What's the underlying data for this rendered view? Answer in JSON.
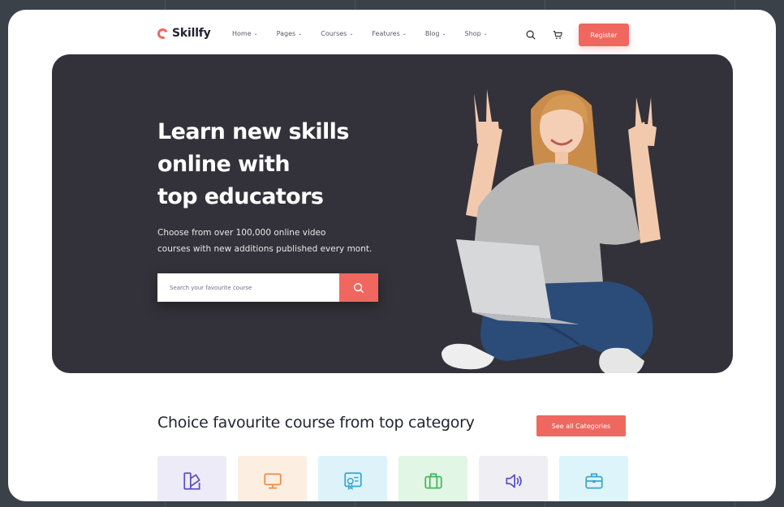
{
  "brand": {
    "name": "Skillfy",
    "accent": "#f0675f"
  },
  "nav": {
    "items": [
      {
        "label": "Home"
      },
      {
        "label": "Pages"
      },
      {
        "label": "Courses"
      },
      {
        "label": "Features"
      },
      {
        "label": "Blog"
      },
      {
        "label": "Shop"
      }
    ],
    "icons": [
      "search-icon",
      "cart-icon"
    ],
    "register_label": "Register"
  },
  "hero": {
    "title_lines": [
      "Learn new skills",
      "online with",
      "top educators"
    ],
    "subtitle_lines": [
      "Choose from over 100,000 online video",
      "courses with new additions published every mont."
    ],
    "search": {
      "placeholder": "Search your favourite course"
    },
    "background": "#33323a"
  },
  "categories": {
    "title": "Choice favourite course from top category",
    "button_label": "See all Categories",
    "cards": [
      {
        "icon": "design-icon",
        "bg": "#ecebf7",
        "color": "#5a4fc8"
      },
      {
        "icon": "monitor-icon",
        "bg": "#fdeee2",
        "color": "#f08a4b"
      },
      {
        "icon": "certificate-icon",
        "bg": "#ddf3f9",
        "color": "#3aa6cf"
      },
      {
        "icon": "briefcase-icon",
        "bg": "#e1f6e4",
        "color": "#45b55a"
      },
      {
        "icon": "megaphone-icon",
        "bg": "#eeeef3",
        "color": "#5a4fc8"
      },
      {
        "icon": "toolbox-icon",
        "bg": "#ddf5fa",
        "color": "#3aa6cf"
      }
    ]
  }
}
